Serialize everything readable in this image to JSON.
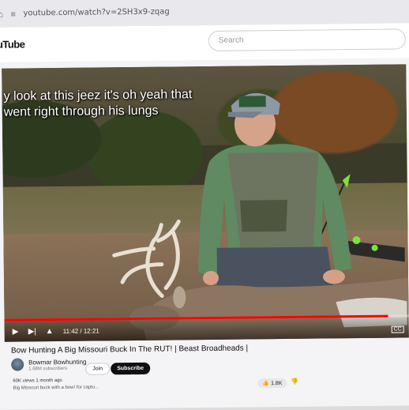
{
  "browser": {
    "url": "youtube.com/watch?v=2SH3x9-zqag",
    "home_icon": "home-icon",
    "site_settings_icon": "tune-icon"
  },
  "header": {
    "logo": "uTube",
    "search_placeholder": "Search"
  },
  "video": {
    "caption_line1": "y look at this jeez it's oh yeah that",
    "caption_line2": "went right through his lungs",
    "hat_text": "BOWMAR BOWHUNTING",
    "current_time": "11:42 / 12:21",
    "progress": 0.95,
    "cc_label": "CC"
  },
  "details": {
    "title": "Bow Hunting A Big Missouri Buck In The RUT! | Beast Broadheads |",
    "channel_name": "Bowmar Bowhunting",
    "subscribers": "1.68M subscribers",
    "join_label": "Join",
    "subscribe_label": "Subscribe",
    "views": "60K views  1 month ago",
    "description": "Big Missouri buck with a bow! for captu...",
    "likes": "1.8K"
  },
  "colors": {
    "accent": "#ff0000",
    "subscribe_bg": "#0f0f0f"
  }
}
